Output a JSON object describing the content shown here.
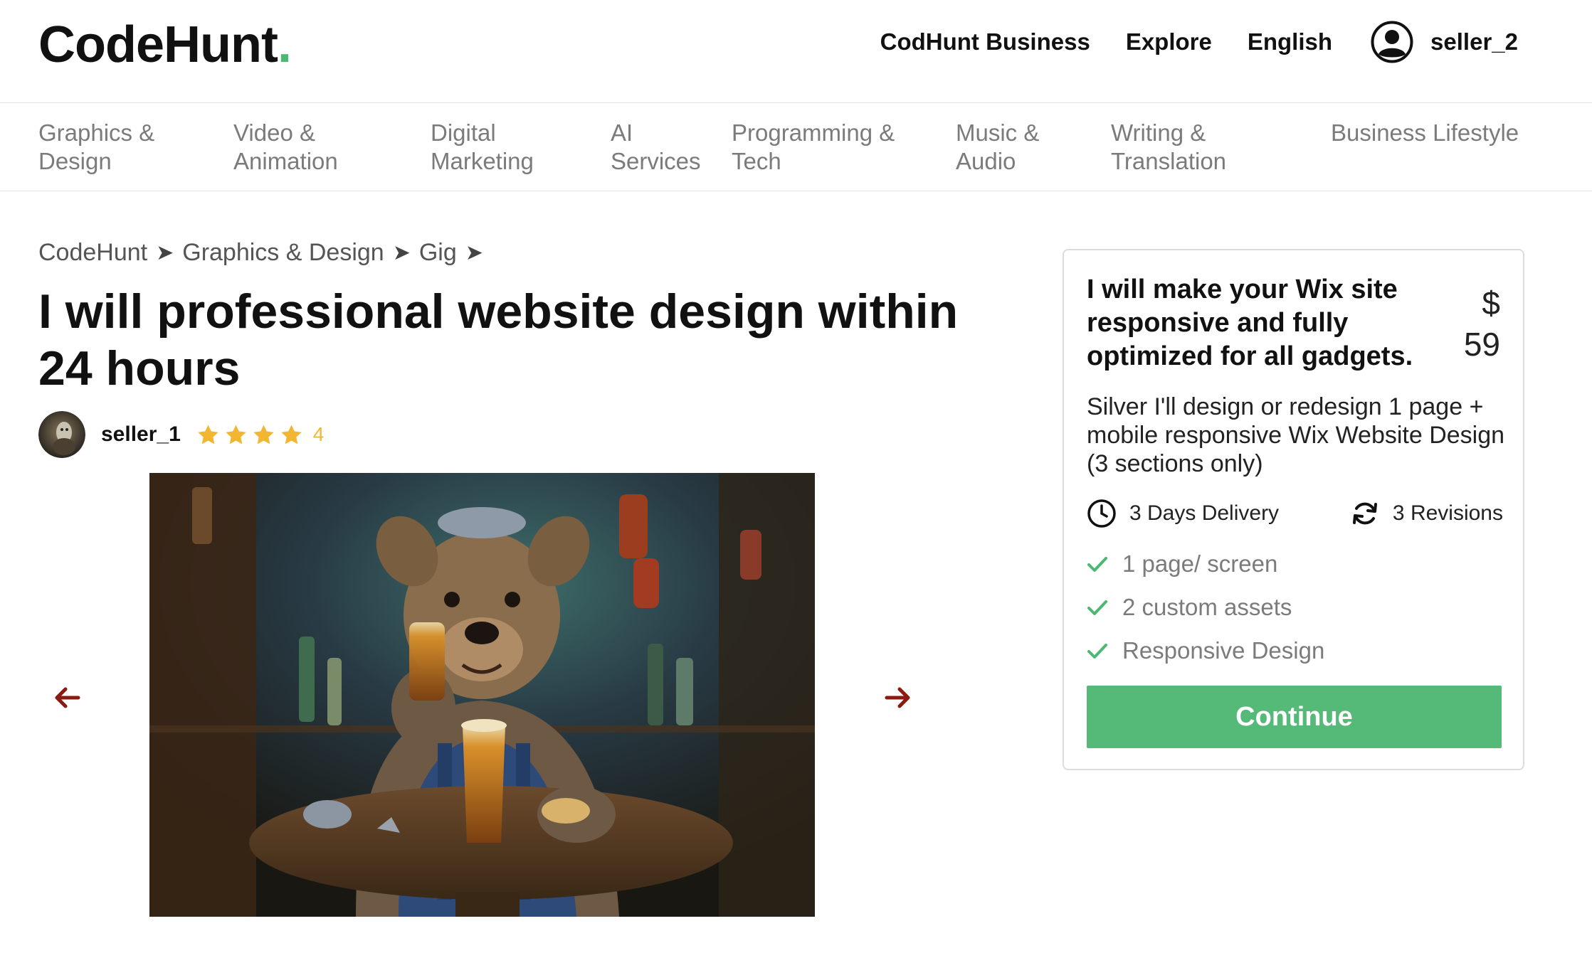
{
  "brand": {
    "name": "CodeHunt",
    "dot": ".",
    "accent_color": "#4cb873"
  },
  "header": {
    "nav": [
      "CodHunt Business",
      "Explore",
      "English"
    ],
    "username": "seller_2",
    "user_icon": "user-circle-icon"
  },
  "categories": [
    "Graphics &\nDesign",
    "Video &\nAnimation",
    "Digital\nMarketing",
    "AI\nServices",
    "Programming &\nTech",
    "Music &\nAudio",
    "Writing &\nTranslation",
    "Business Lifestyle"
  ],
  "breadcrumb": [
    "CodeHunt",
    "Graphics & Design",
    "Gig"
  ],
  "breadcrumb_separator": "➤",
  "gig": {
    "title": "I will professional website design within 24 hours",
    "seller": "seller_1",
    "rating": 4,
    "rating_label": "4",
    "image_alt": "dog-in-overalls-drinking-beer-painting",
    "prev_icon": "arrow-left-icon",
    "next_icon": "arrow-right-icon",
    "arrow_color": "#8b1a10"
  },
  "package": {
    "title": "I will make your Wix site responsive and fully optimized for all gadgets.",
    "currency": "$",
    "price": "59",
    "description": "Silver I'll design or redesign 1 page + mobile responsive Wix Website Design (3 sections only)",
    "delivery": "3 Days Delivery",
    "delivery_icon": "clock-icon",
    "revisions": "3 Revisions",
    "revisions_icon": "refresh-icon",
    "features": [
      "1 page/ screen",
      "2 custom assets",
      "Responsive Design"
    ],
    "feature_icon": "check-icon",
    "button": "Continue",
    "button_color": "#55b978"
  }
}
